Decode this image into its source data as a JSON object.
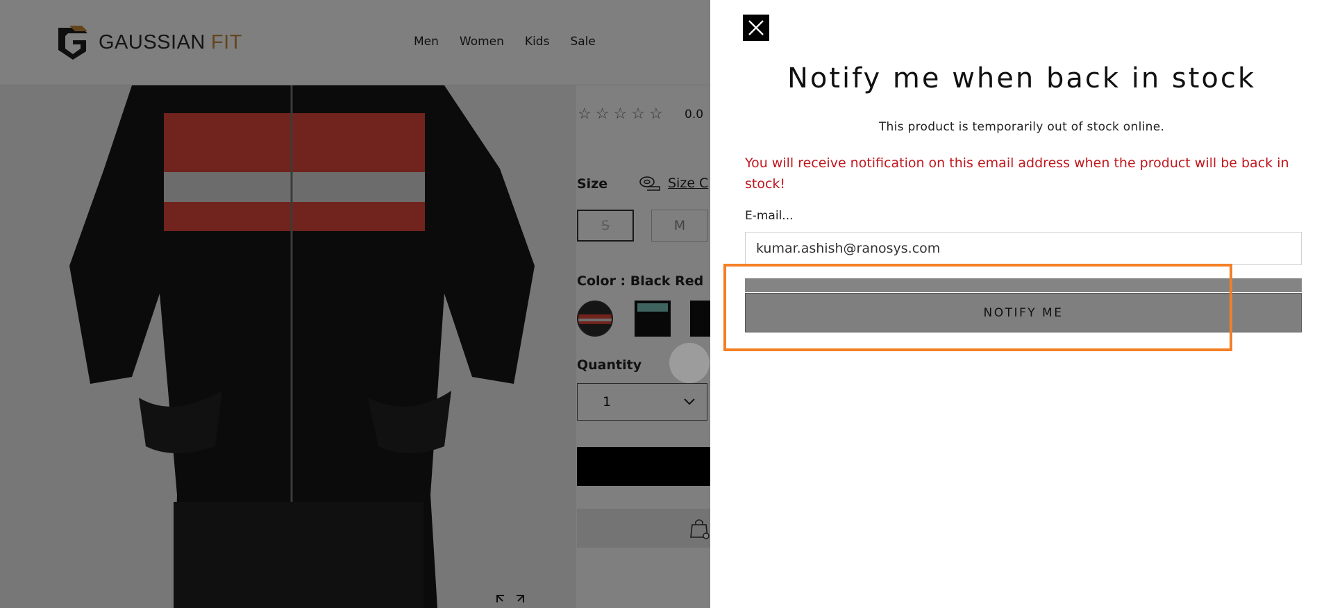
{
  "header": {
    "logo_text": "GAUSSIAN",
    "logo_accent": "FIT",
    "nav": [
      "Men",
      "Women",
      "Kids",
      "Sale"
    ]
  },
  "product": {
    "rating": "0.0",
    "size_label": "Size",
    "size_chart_label": "Size C",
    "sizes": [
      "S",
      "M"
    ],
    "color_label": "Color : Black Red",
    "quantity_label": "Quantity",
    "quantity_value": "1"
  },
  "drawer": {
    "title": "Notify me when back in stock",
    "subtitle": "This product is temporarily out of stock online.",
    "notice": "You will receive notification on this email address when the product will be back in stock!",
    "email_label": "E-mail...",
    "email_value": "kumar.ashish@ranosys.com",
    "notify_label": "NOTIFY ME"
  },
  "colors": {
    "overlay": "#000000",
    "notice_red": "#c0181e",
    "highlight_orange": "#f47f24",
    "button_gray": "#7f7f7f",
    "logo_gold": "#c78a3a"
  },
  "icons": {
    "close": "close-icon",
    "chevron": "chevron-down-icon",
    "tape": "measuring-tape-icon",
    "bag": "shopping-bag-icon",
    "expand": "expand-icon"
  }
}
